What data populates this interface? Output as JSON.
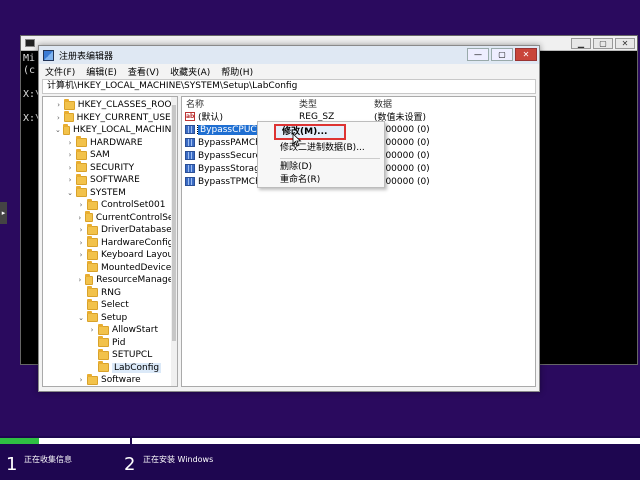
{
  "console": {
    "lines": [
      "Mi",
      "(c",
      "",
      "X:\\",
      "",
      "X:\\"
    ],
    "buttons": [
      "▁",
      "▢",
      "✕"
    ]
  },
  "side_tab": "▸",
  "window": {
    "title": "注册表编辑器",
    "buttons": {
      "minimize": "—",
      "maximize": "▢",
      "close": "✕"
    }
  },
  "menu": [
    "文件(F)",
    "编辑(E)",
    "查看(V)",
    "收藏夹(A)",
    "帮助(H)"
  ],
  "address": "计算机\\HKEY_LOCAL_MACHINE\\SYSTEM\\Setup\\LabConfig",
  "tree": [
    {
      "label": "HKEY_CLASSES_ROOT",
      "indent": 0,
      "chev": "›"
    },
    {
      "label": "HKEY_CURRENT_USER",
      "indent": 0,
      "chev": "›"
    },
    {
      "label": "HKEY_LOCAL_MACHINE",
      "indent": 0,
      "chev": "⌄"
    },
    {
      "label": "HARDWARE",
      "indent": 1,
      "chev": "›"
    },
    {
      "label": "SAM",
      "indent": 1,
      "chev": "›"
    },
    {
      "label": "SECURITY",
      "indent": 1,
      "chev": "›"
    },
    {
      "label": "SOFTWARE",
      "indent": 1,
      "chev": "›"
    },
    {
      "label": "SYSTEM",
      "indent": 1,
      "chev": "⌄"
    },
    {
      "label": "ControlSet001",
      "indent": 2,
      "chev": "›"
    },
    {
      "label": "CurrentControlSet",
      "indent": 2,
      "chev": "›"
    },
    {
      "label": "DriverDatabase",
      "indent": 2,
      "chev": "›"
    },
    {
      "label": "HardwareConfig",
      "indent": 2,
      "chev": "›"
    },
    {
      "label": "Keyboard Layout",
      "indent": 2,
      "chev": "›"
    },
    {
      "label": "MountedDevices",
      "indent": 2,
      "chev": ""
    },
    {
      "label": "ResourceManager",
      "indent": 2,
      "chev": "›"
    },
    {
      "label": "RNG",
      "indent": 2,
      "chev": ""
    },
    {
      "label": "Select",
      "indent": 2,
      "chev": ""
    },
    {
      "label": "Setup",
      "indent": 2,
      "chev": "⌄"
    },
    {
      "label": "AllowStart",
      "indent": 3,
      "chev": "›"
    },
    {
      "label": "Pid",
      "indent": 3,
      "chev": ""
    },
    {
      "label": "SETUPCL",
      "indent": 3,
      "chev": ""
    },
    {
      "label": "LabConfig",
      "indent": 3,
      "chev": "",
      "selected": true
    },
    {
      "label": "Software",
      "indent": 2,
      "chev": "›"
    }
  ],
  "values_header": {
    "name": "名称",
    "type": "类型",
    "data": "数据"
  },
  "values": [
    {
      "name": "(默认)",
      "type": "REG_SZ",
      "data": "(数值未设置)",
      "icon": "ab"
    },
    {
      "name": "BypassCPUCheck",
      "type": "",
      "data": "0000000 (0)",
      "icon": "bin",
      "selected": true
    },
    {
      "name": "BypassPAMCheck",
      "type": "",
      "data": "0000000 (0)",
      "icon": "bin"
    },
    {
      "name": "BypassSecureBoo",
      "type": "",
      "data": "0000000 (0)",
      "icon": "bin"
    },
    {
      "name": "BypassStorageCh",
      "type": "",
      "data": "0000000 (0)",
      "icon": "bin"
    },
    {
      "name": "BypassTPMCheck",
      "type": "",
      "data": "0000000 (0)",
      "icon": "bin"
    }
  ],
  "context_menu": {
    "modify": "修改(M)...",
    "modify_binary": "修改二进制数据(B)...",
    "delete": "删除(D)",
    "rename": "重命名(R)"
  },
  "setup_steps": [
    {
      "num": "1",
      "label": "正在收集信息"
    },
    {
      "num": "2",
      "label": "正在安装 Windows"
    }
  ],
  "setup_progress": 0.3
}
